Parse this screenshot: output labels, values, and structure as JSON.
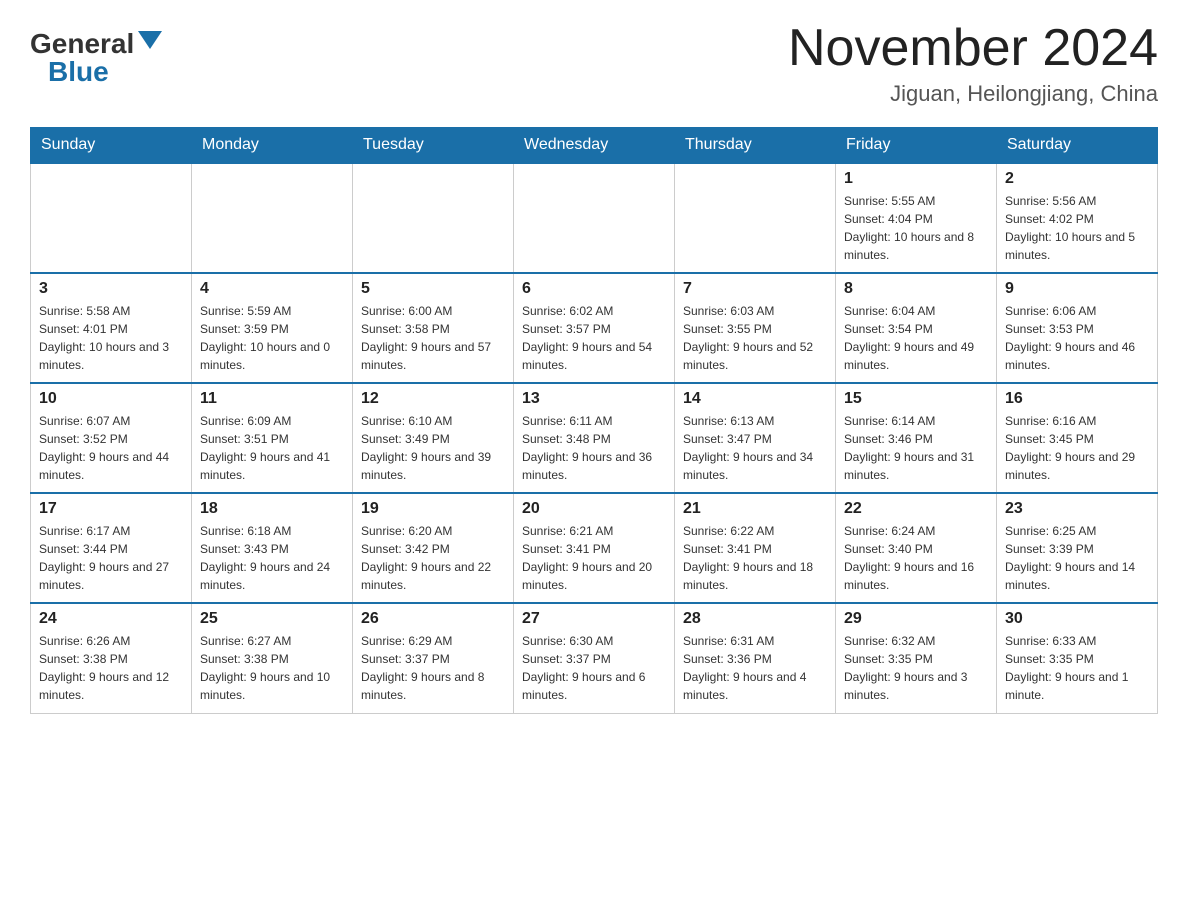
{
  "header": {
    "logo_general": "General",
    "logo_blue": "Blue",
    "month_year": "November 2024",
    "location": "Jiguan, Heilongjiang, China"
  },
  "days_of_week": [
    "Sunday",
    "Monday",
    "Tuesday",
    "Wednesday",
    "Thursday",
    "Friday",
    "Saturday"
  ],
  "weeks": [
    [
      {
        "day": "",
        "sunrise": "",
        "sunset": "",
        "daylight": ""
      },
      {
        "day": "",
        "sunrise": "",
        "sunset": "",
        "daylight": ""
      },
      {
        "day": "",
        "sunrise": "",
        "sunset": "",
        "daylight": ""
      },
      {
        "day": "",
        "sunrise": "",
        "sunset": "",
        "daylight": ""
      },
      {
        "day": "",
        "sunrise": "",
        "sunset": "",
        "daylight": ""
      },
      {
        "day": "1",
        "sunrise": "Sunrise: 5:55 AM",
        "sunset": "Sunset: 4:04 PM",
        "daylight": "Daylight: 10 hours and 8 minutes."
      },
      {
        "day": "2",
        "sunrise": "Sunrise: 5:56 AM",
        "sunset": "Sunset: 4:02 PM",
        "daylight": "Daylight: 10 hours and 5 minutes."
      }
    ],
    [
      {
        "day": "3",
        "sunrise": "Sunrise: 5:58 AM",
        "sunset": "Sunset: 4:01 PM",
        "daylight": "Daylight: 10 hours and 3 minutes."
      },
      {
        "day": "4",
        "sunrise": "Sunrise: 5:59 AM",
        "sunset": "Sunset: 3:59 PM",
        "daylight": "Daylight: 10 hours and 0 minutes."
      },
      {
        "day": "5",
        "sunrise": "Sunrise: 6:00 AM",
        "sunset": "Sunset: 3:58 PM",
        "daylight": "Daylight: 9 hours and 57 minutes."
      },
      {
        "day": "6",
        "sunrise": "Sunrise: 6:02 AM",
        "sunset": "Sunset: 3:57 PM",
        "daylight": "Daylight: 9 hours and 54 minutes."
      },
      {
        "day": "7",
        "sunrise": "Sunrise: 6:03 AM",
        "sunset": "Sunset: 3:55 PM",
        "daylight": "Daylight: 9 hours and 52 minutes."
      },
      {
        "day": "8",
        "sunrise": "Sunrise: 6:04 AM",
        "sunset": "Sunset: 3:54 PM",
        "daylight": "Daylight: 9 hours and 49 minutes."
      },
      {
        "day": "9",
        "sunrise": "Sunrise: 6:06 AM",
        "sunset": "Sunset: 3:53 PM",
        "daylight": "Daylight: 9 hours and 46 minutes."
      }
    ],
    [
      {
        "day": "10",
        "sunrise": "Sunrise: 6:07 AM",
        "sunset": "Sunset: 3:52 PM",
        "daylight": "Daylight: 9 hours and 44 minutes."
      },
      {
        "day": "11",
        "sunrise": "Sunrise: 6:09 AM",
        "sunset": "Sunset: 3:51 PM",
        "daylight": "Daylight: 9 hours and 41 minutes."
      },
      {
        "day": "12",
        "sunrise": "Sunrise: 6:10 AM",
        "sunset": "Sunset: 3:49 PM",
        "daylight": "Daylight: 9 hours and 39 minutes."
      },
      {
        "day": "13",
        "sunrise": "Sunrise: 6:11 AM",
        "sunset": "Sunset: 3:48 PM",
        "daylight": "Daylight: 9 hours and 36 minutes."
      },
      {
        "day": "14",
        "sunrise": "Sunrise: 6:13 AM",
        "sunset": "Sunset: 3:47 PM",
        "daylight": "Daylight: 9 hours and 34 minutes."
      },
      {
        "day": "15",
        "sunrise": "Sunrise: 6:14 AM",
        "sunset": "Sunset: 3:46 PM",
        "daylight": "Daylight: 9 hours and 31 minutes."
      },
      {
        "day": "16",
        "sunrise": "Sunrise: 6:16 AM",
        "sunset": "Sunset: 3:45 PM",
        "daylight": "Daylight: 9 hours and 29 minutes."
      }
    ],
    [
      {
        "day": "17",
        "sunrise": "Sunrise: 6:17 AM",
        "sunset": "Sunset: 3:44 PM",
        "daylight": "Daylight: 9 hours and 27 minutes."
      },
      {
        "day": "18",
        "sunrise": "Sunrise: 6:18 AM",
        "sunset": "Sunset: 3:43 PM",
        "daylight": "Daylight: 9 hours and 24 minutes."
      },
      {
        "day": "19",
        "sunrise": "Sunrise: 6:20 AM",
        "sunset": "Sunset: 3:42 PM",
        "daylight": "Daylight: 9 hours and 22 minutes."
      },
      {
        "day": "20",
        "sunrise": "Sunrise: 6:21 AM",
        "sunset": "Sunset: 3:41 PM",
        "daylight": "Daylight: 9 hours and 20 minutes."
      },
      {
        "day": "21",
        "sunrise": "Sunrise: 6:22 AM",
        "sunset": "Sunset: 3:41 PM",
        "daylight": "Daylight: 9 hours and 18 minutes."
      },
      {
        "day": "22",
        "sunrise": "Sunrise: 6:24 AM",
        "sunset": "Sunset: 3:40 PM",
        "daylight": "Daylight: 9 hours and 16 minutes."
      },
      {
        "day": "23",
        "sunrise": "Sunrise: 6:25 AM",
        "sunset": "Sunset: 3:39 PM",
        "daylight": "Daylight: 9 hours and 14 minutes."
      }
    ],
    [
      {
        "day": "24",
        "sunrise": "Sunrise: 6:26 AM",
        "sunset": "Sunset: 3:38 PM",
        "daylight": "Daylight: 9 hours and 12 minutes."
      },
      {
        "day": "25",
        "sunrise": "Sunrise: 6:27 AM",
        "sunset": "Sunset: 3:38 PM",
        "daylight": "Daylight: 9 hours and 10 minutes."
      },
      {
        "day": "26",
        "sunrise": "Sunrise: 6:29 AM",
        "sunset": "Sunset: 3:37 PM",
        "daylight": "Daylight: 9 hours and 8 minutes."
      },
      {
        "day": "27",
        "sunrise": "Sunrise: 6:30 AM",
        "sunset": "Sunset: 3:37 PM",
        "daylight": "Daylight: 9 hours and 6 minutes."
      },
      {
        "day": "28",
        "sunrise": "Sunrise: 6:31 AM",
        "sunset": "Sunset: 3:36 PM",
        "daylight": "Daylight: 9 hours and 4 minutes."
      },
      {
        "day": "29",
        "sunrise": "Sunrise: 6:32 AM",
        "sunset": "Sunset: 3:35 PM",
        "daylight": "Daylight: 9 hours and 3 minutes."
      },
      {
        "day": "30",
        "sunrise": "Sunrise: 6:33 AM",
        "sunset": "Sunset: 3:35 PM",
        "daylight": "Daylight: 9 hours and 1 minute."
      }
    ]
  ]
}
